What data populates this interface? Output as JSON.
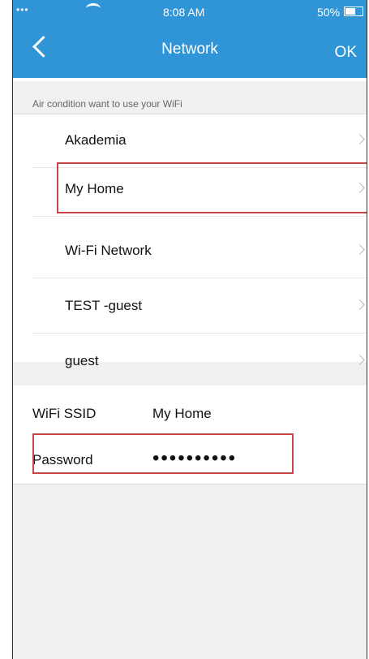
{
  "status": {
    "signal": "•••",
    "time": "8:08 AM",
    "battery": "50%"
  },
  "nav": {
    "title": "Network",
    "ok_label": "OK"
  },
  "hint": "Air condition want to use your WiFi",
  "networks": [
    {
      "label": "Akademia"
    },
    {
      "label": "My Home"
    },
    {
      "label": "Wi-Fi Network"
    },
    {
      "label": "TEST -guest"
    },
    {
      "label": "guest"
    }
  ],
  "form": {
    "ssid_label": "WiFi SSID",
    "ssid_value": "My Home",
    "password_label": "Password",
    "password_value": "••••••••••"
  }
}
